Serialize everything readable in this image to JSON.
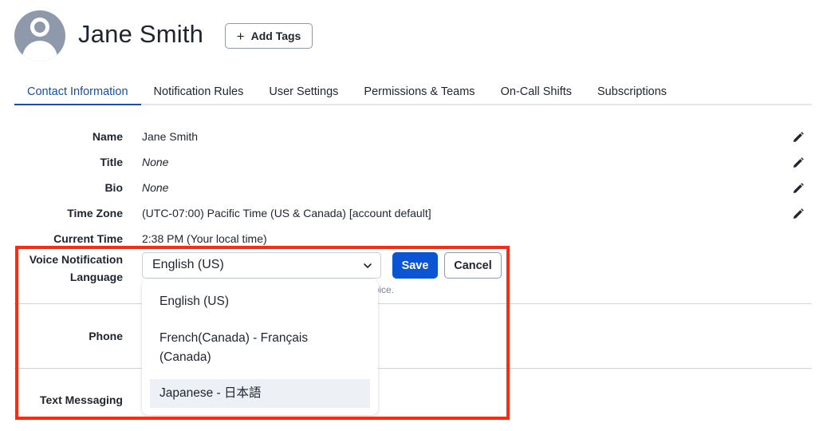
{
  "header": {
    "user_name": "Jane Smith",
    "avatar_icon": "user-avatar-icon",
    "add_tags_label": "Add Tags",
    "add_tags_icon": "plus-icon"
  },
  "tabs": [
    {
      "label": "Contact Information",
      "active": true
    },
    {
      "label": "Notification Rules",
      "active": false
    },
    {
      "label": "User Settings",
      "active": false
    },
    {
      "label": "Permissions & Teams",
      "active": false
    },
    {
      "label": "On-Call Shifts",
      "active": false
    },
    {
      "label": "Subscriptions",
      "active": false
    }
  ],
  "fields": {
    "name": {
      "label": "Name",
      "value": "Jane Smith",
      "editable": true
    },
    "title": {
      "label": "Title",
      "value": "None",
      "editable": true
    },
    "bio": {
      "label": "Bio",
      "value": "None",
      "editable": true
    },
    "time_zone": {
      "label": "Time Zone",
      "value": "(UTC-07:00) Pacific Time (US & Canada) [account default]",
      "editable": true
    },
    "current_time": {
      "label": "Current Time",
      "value": "2:38 PM (Your local time)"
    },
    "voice_language": {
      "label_line1": "Voice Notification",
      "label_line2": "Language",
      "selected": "English (US)",
      "hint_visible_fragment": "hoice.",
      "options": [
        {
          "label": "English (US)",
          "highlighted": false
        },
        {
          "label_line1": "French(Canada) - Français",
          "label_line2": "(Canada)",
          "highlighted": false
        },
        {
          "label": "Japanese - 日本語",
          "highlighted": true
        }
      ],
      "save_label": "Save",
      "cancel_label": "Cancel"
    },
    "phone": {
      "label": "Phone"
    },
    "text_messaging": {
      "label": "Text Messaging"
    }
  },
  "colors": {
    "accent": "#174ea6",
    "primary_button": "#0b55d4",
    "highlight_box": "#ff2a12",
    "option_hover": "#edf1f5"
  }
}
